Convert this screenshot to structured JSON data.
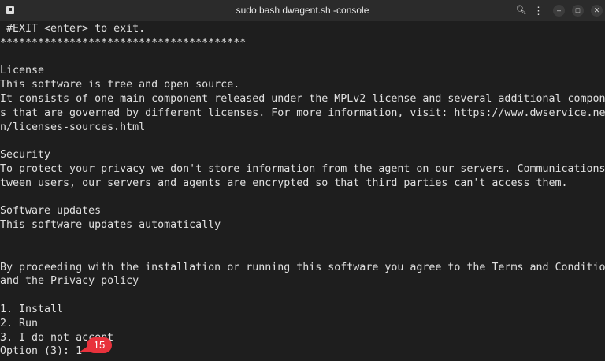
{
  "window": {
    "title": "sudo bash dwagent.sh -console",
    "icons": [
      "terminal-icon",
      "search-icon",
      "menu-icon",
      "minimize-icon",
      "maximize-icon",
      "close-icon"
    ]
  },
  "terminal": {
    "lines": [
      " #EXIT <enter> to exit.",
      "***************************************",
      "",
      "License",
      "This software is free and open source.",
      "It consists of one main component released under the MPLv2 license and several additional component",
      "s that are governed by different licenses. For more information, visit: https://www.dwservice.net/e",
      "n/licenses-sources.html",
      "",
      "Security",
      "To protect your privacy we don't store information from the agent on our servers. Communications be",
      "tween users, our servers and agents are encrypted so that third parties can't access them.",
      "",
      "Software updates",
      "This software updates automatically",
      "",
      "",
      "By proceeding with the installation or running this software you agree to the Terms and Conditions",
      "and the Privacy policy",
      "",
      "1. Install",
      "2. Run",
      "3. I do not accept",
      "Option (3): 1"
    ]
  },
  "annotation": {
    "step": "15",
    "color": "#e8323c"
  }
}
